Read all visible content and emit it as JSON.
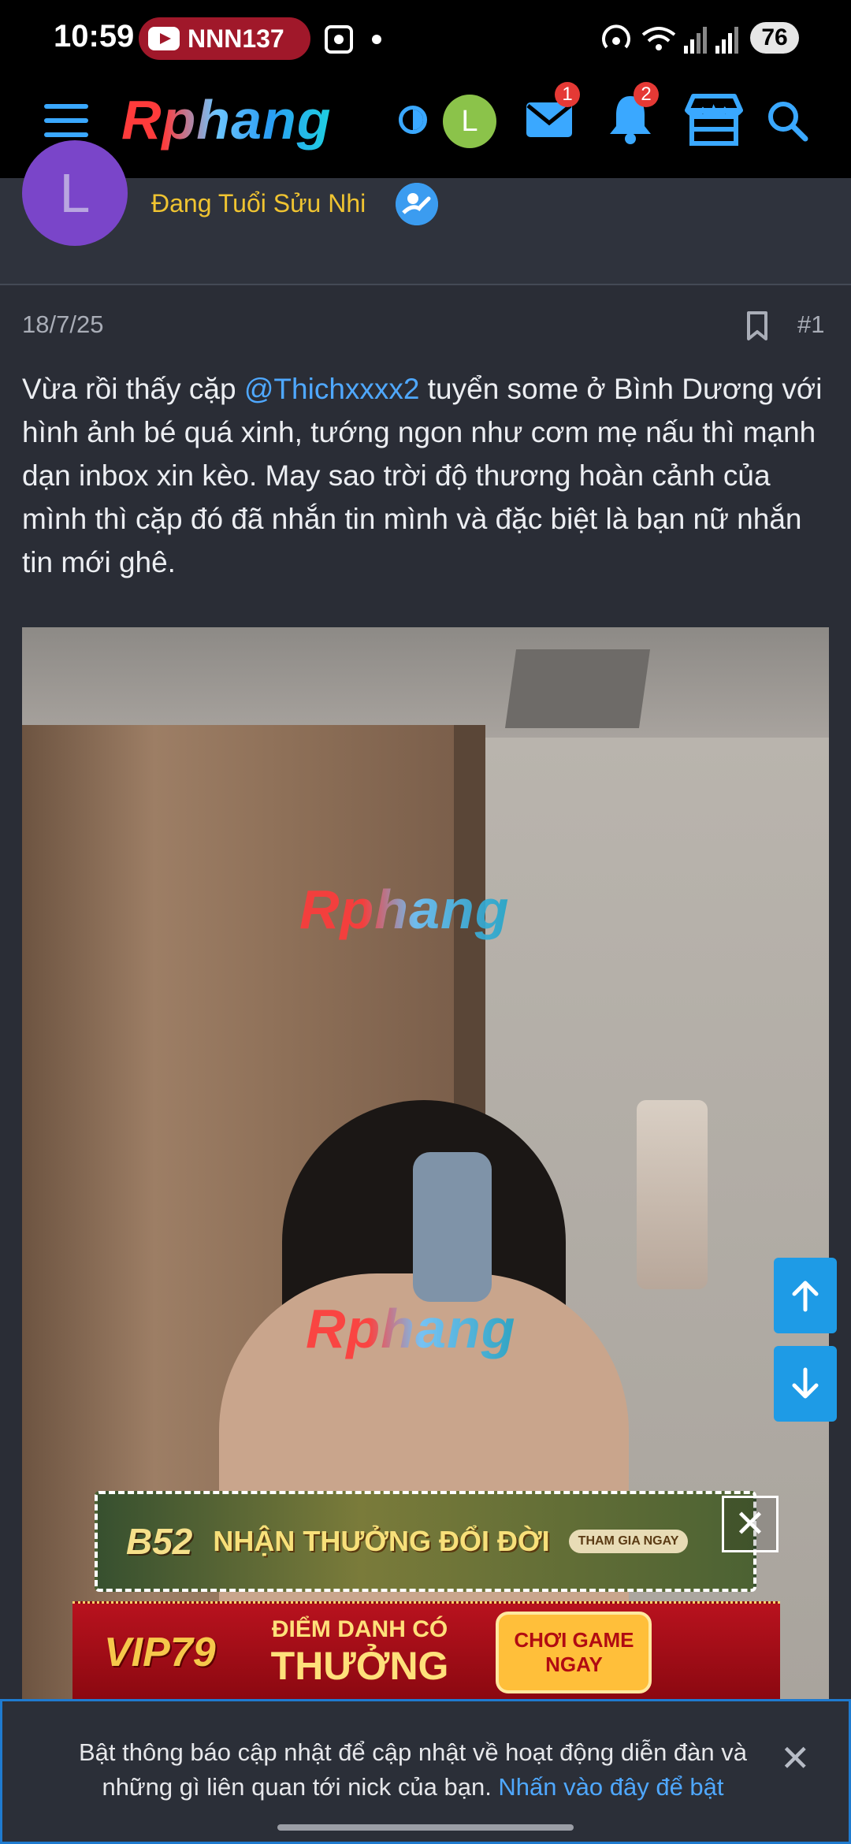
{
  "status_bar": {
    "time": "10:59",
    "media_pill": "NNN137",
    "battery": "76"
  },
  "header": {
    "logo": "Rphang",
    "user_initial": "L",
    "messages_badge": "1",
    "alerts_badge": "2"
  },
  "author": {
    "avatar_initial": "L",
    "user_title": "Đang Tuổi Sửu Nhi"
  },
  "post": {
    "date": "18/7/25",
    "number": "#1",
    "text_before_mention": "Vừa rồi thấy cặp ",
    "mention": "@Thichxxxx2",
    "text_after_mention": " tuyển some ở Bình Dương với hình ảnh bé quá xinh, tướng ngon như cơm mẹ nấu thì mạnh dạn inbox xin kèo. May sao trời độ thương hoàn cảnh của mình thì cặp đó đã nhắn tin mình và đặc biệt là bạn nữ nhắn tin mới ghê.",
    "watermark": "Rphang"
  },
  "ads": {
    "b52_brand": "B52",
    "b52_headline": "NHẬN THƯỞNG ĐỔI ĐỜI",
    "b52_cta": "THAM GIA NGAY",
    "close": "✕",
    "vip_brand": "VIP79",
    "vip_line1": "ĐIỂM DANH CÓ",
    "vip_line2": "THƯỞNG",
    "vip_cta1": "CHƠI GAME",
    "vip_cta2": "NGAY"
  },
  "notification": {
    "text": "Bật thông báo cập nhật để cập nhật về hoạt động diễn đàn và những gì liên quan tới nick của bạn. ",
    "link": "Nhấn vào đây để bật",
    "close": "✕"
  }
}
